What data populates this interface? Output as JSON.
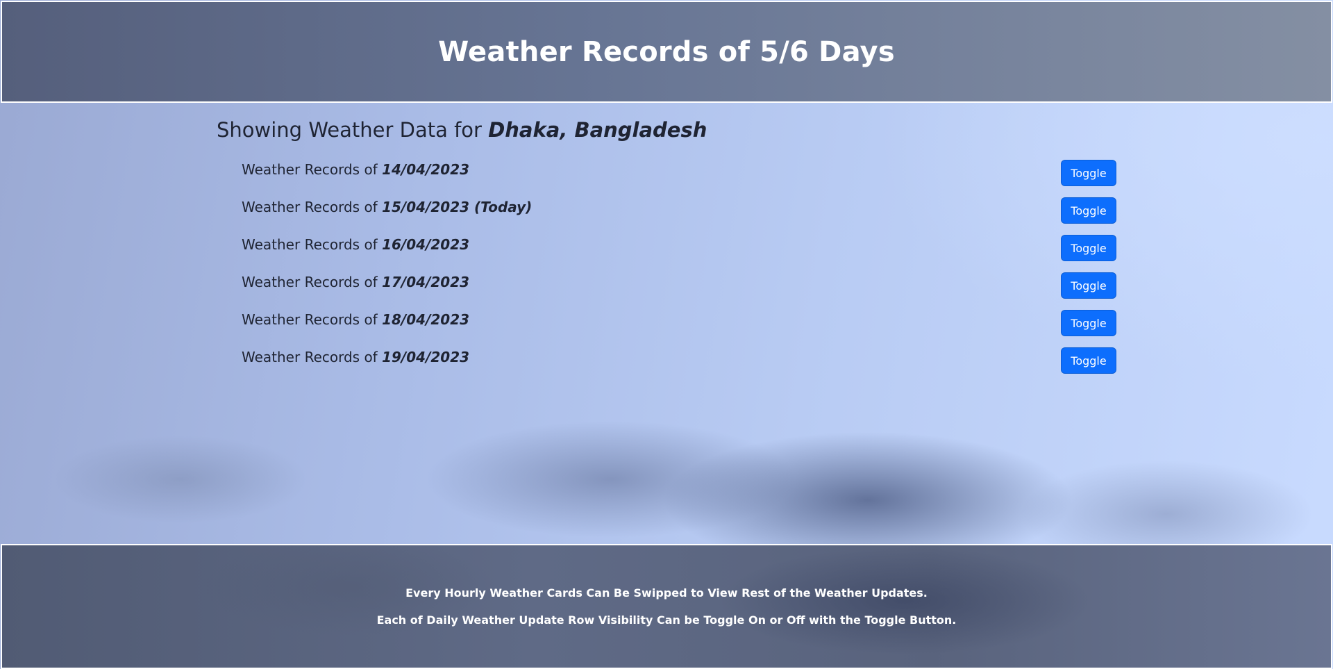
{
  "header": {
    "title": "Weather Records of 5/6 Days"
  },
  "location": {
    "prefix": "Showing Weather Data for ",
    "city": "Dhaka, Bangladesh"
  },
  "days": [
    {
      "prefix": "Weather Records of ",
      "date": "14/04/2023",
      "button": "Toggle"
    },
    {
      "prefix": "Weather Records of ",
      "date": "15/04/2023 (Today)",
      "button": "Toggle"
    },
    {
      "prefix": "Weather Records of ",
      "date": "16/04/2023",
      "button": "Toggle"
    },
    {
      "prefix": "Weather Records of ",
      "date": "17/04/2023",
      "button": "Toggle"
    },
    {
      "prefix": "Weather Records of ",
      "date": "18/04/2023",
      "button": "Toggle"
    },
    {
      "prefix": "Weather Records of ",
      "date": "19/04/2023",
      "button": "Toggle"
    }
  ],
  "footer": {
    "line1": "Every Hourly Weather Cards Can Be Swipped to View Rest of the Weather Updates.",
    "line2": "Each of Daily Weather Update Row Visibility Can be Toggle On or Off with the Toggle Button."
  },
  "colors": {
    "button": "#0d6efd",
    "header_bg": "#677594",
    "footer_bg": "#5f6a86"
  }
}
